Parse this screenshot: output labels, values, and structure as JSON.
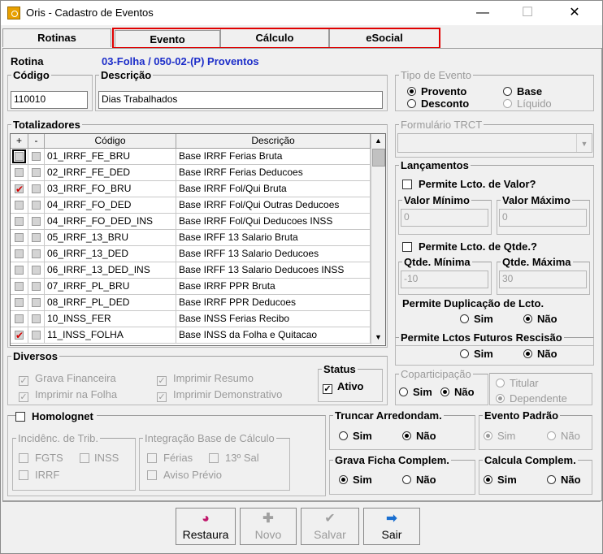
{
  "window": {
    "title": "Oris - Cadastro de Eventos",
    "min": "—",
    "max": "☐",
    "close": "✕"
  },
  "tabs": [
    {
      "label": "Rotinas"
    },
    {
      "label": "Evento"
    },
    {
      "label": "Cálculo"
    },
    {
      "label": "eSocial"
    }
  ],
  "highlight_color": "#e00000",
  "rotina": {
    "label": "Rotina",
    "value": "03-Folha / 050-02-(P) Proventos"
  },
  "codigo": {
    "label": "Código",
    "value": "110010"
  },
  "descricao": {
    "label": "Descrição",
    "value": "Dias Trabalhados"
  },
  "tipo_evento": {
    "label": "Tipo de Evento",
    "options": [
      {
        "label": "Provento",
        "selected": true
      },
      {
        "label": "Base",
        "selected": false
      },
      {
        "label": "Desconto",
        "selected": false
      },
      {
        "label": "Líquido",
        "selected": false
      }
    ]
  },
  "totalizadores": {
    "label": "Totalizadores",
    "headers": [
      "+",
      "-",
      "Código",
      "Descrição"
    ],
    "rows": [
      {
        "codigo": "01_IRRF_FE_BRU",
        "descricao": "Base IRRF Ferias Bruta",
        "checked": false
      },
      {
        "codigo": "02_IRRF_FE_DED",
        "descricao": "Base IRRF Ferias Deducoes",
        "checked": false
      },
      {
        "codigo": "03_IRRF_FO_BRU",
        "descricao": "Base IRRF Fol/Qui Bruta",
        "checked": true
      },
      {
        "codigo": "04_IRRF_FO_DED",
        "descricao": "Base IRRF Fol/Qui Outras Deducoes",
        "checked": false
      },
      {
        "codigo": "04_IRRF_FO_DED_INS",
        "descricao": "Base IRRF Fol/Qui Deducoes INSS",
        "checked": false
      },
      {
        "codigo": "05_IRRF_13_BRU",
        "descricao": "Base IRFF 13 Salario Bruta",
        "checked": false
      },
      {
        "codigo": "06_IRRF_13_DED",
        "descricao": "Base IRFF 13 Salario Deducoes",
        "checked": false
      },
      {
        "codigo": "06_IRRF_13_DED_INS",
        "descricao": "Base IRFF 13 Salario Deducoes INSS",
        "checked": false
      },
      {
        "codigo": "07_IRRF_PL_BRU",
        "descricao": "Base IRRF PPR Bruta",
        "checked": false
      },
      {
        "codigo": "08_IRRF_PL_DED",
        "descricao": "Base IRRF PPR Deducoes",
        "checked": false
      },
      {
        "codigo": "10_INSS_FER",
        "descricao": "Base INSS Ferias Recibo",
        "checked": false
      },
      {
        "codigo": "11_INSS_FOLHA",
        "descricao": "Base INSS da Folha e Quitacao",
        "checked": true
      }
    ]
  },
  "formulario_trct": {
    "label": "Formulário TRCT",
    "value": ""
  },
  "lancamentos": {
    "label": "Lançamentos",
    "permite_valor": "Permite Lcto. de Valor?",
    "valor_minimo": {
      "label": "Valor Mínimo",
      "value": "0"
    },
    "valor_maximo": {
      "label": "Valor Máximo",
      "value": "0"
    },
    "permite_qtde": "Permite Lcto. de Qtde.?",
    "qtde_minima": {
      "label": "Qtde. Mínima",
      "value": "-10"
    },
    "qtde_maxima": {
      "label": "Qtde. Máxima",
      "value": "30"
    },
    "duplicacao": {
      "label": "Permite Duplicação de Lcto.",
      "sim": "Sim",
      "nao": "Não"
    }
  },
  "futuros": {
    "label": "Permite Lctos Futuros Rescisão",
    "sim": "Sim",
    "nao": "Não"
  },
  "diversos": {
    "label": "Diversos",
    "items": [
      "Grava Financeira",
      "Imprimir Resumo",
      "Imprimir na Folha",
      "Imprimir Demonstrativo"
    ]
  },
  "status": {
    "label": "Status",
    "ativo": "Ativo"
  },
  "coparticipacao": {
    "label": "Coparticipação",
    "sim": "Sim",
    "nao": "Não",
    "titular": "Titular",
    "dependente": "Dependente"
  },
  "homolognet": {
    "label": "Homolognet"
  },
  "incidencia": {
    "label": "Incidênc. de Trib.",
    "fgts": "FGTS",
    "inss": "INSS",
    "irrf": "IRRF"
  },
  "integracao": {
    "label": "Integração Base de Cálculo",
    "ferias": "Férias",
    "sal13": "13º Sal",
    "aviso": "Aviso Prévio"
  },
  "truncar": {
    "label": "Truncar Arredondam.",
    "sim": "Sim",
    "nao": "Não"
  },
  "evento_padrao": {
    "label": "Evento Padrão",
    "sim": "Sim",
    "nao": "Não"
  },
  "grava_ficha": {
    "label": "Grava Ficha Complem.",
    "sim": "Sim",
    "nao": "Não"
  },
  "calcula_complem": {
    "label": "Calcula Complem.",
    "sim": "Sim",
    "nao": "Não"
  },
  "buttons": [
    {
      "label": "Restaura",
      "icon": "restore-icon"
    },
    {
      "label": "Novo",
      "icon": "plus-icon"
    },
    {
      "label": "Salvar",
      "icon": "checkmark-icon"
    },
    {
      "label": "Sair",
      "icon": "exit-arrow-icon"
    }
  ]
}
